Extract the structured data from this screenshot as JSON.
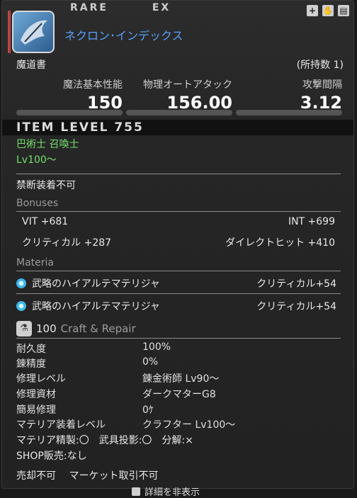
{
  "header": {
    "rarity_label": "RARE",
    "ex_label": "EX",
    "item_name": "ネクロン･インデックス",
    "category": "魔道書",
    "owned": "(所持数 1)"
  },
  "top_icons": [
    "plus-icon",
    "hand-icon",
    "window-icon"
  ],
  "stats": {
    "labels": [
      "魔法基本性能",
      "物理オートアタック",
      "攻撃間隔"
    ],
    "values": [
      "150",
      "156.00",
      "3.12"
    ]
  },
  "item_level": "ITEM LEVEL 755",
  "classes": "巴術士 召喚士",
  "level_req": "Lv100〜",
  "restriction": "禁断装着不可",
  "bonuses": {
    "title": "Bonuses",
    "items": [
      {
        "label": "VIT +681"
      },
      {
        "label": "INT +699"
      },
      {
        "label": "クリティカル +287"
      },
      {
        "label": "ダイレクトヒット +410"
      }
    ]
  },
  "materia": {
    "title": "Materia",
    "items": [
      {
        "name": "武略のハイアルテマテリジャ",
        "stat": "クリティカル+54"
      },
      {
        "name": "武略のハイアルテマテリジャ",
        "stat": "クリティカル+54"
      }
    ]
  },
  "craft": {
    "number": "100",
    "title": "Craft & Repair",
    "rows": [
      {
        "key": "耐久度",
        "value": "100%"
      },
      {
        "key": "錬精度",
        "value": "0%"
      },
      {
        "key": "修理レベル",
        "value": "錬金術師 Lv90〜"
      },
      {
        "key": "修理資材",
        "value": "ダークマターG8"
      },
      {
        "key": "簡易修理",
        "value": "0ｹ"
      },
      {
        "key": "マテリア装着レベル",
        "value": "クラフター Lv100〜"
      }
    ]
  },
  "flags": "マテリア精製:〇　武具投影:〇　分解:×",
  "shop": "SHOP販売:なし",
  "market": "売却不可　 マーケット取引不可",
  "bottom_button": "詳細を非表示"
}
